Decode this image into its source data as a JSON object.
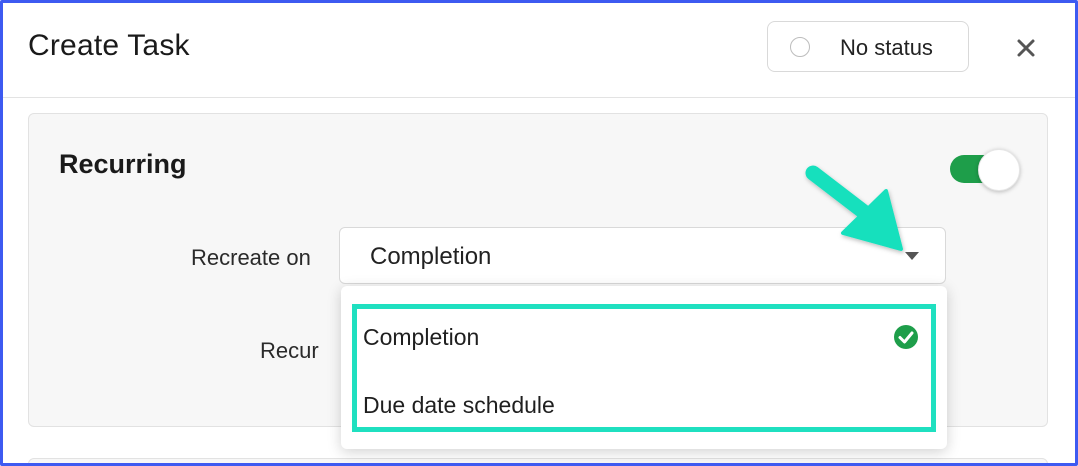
{
  "dialog": {
    "title": "Create Task",
    "status_label": "No status",
    "close_icon": "close-icon"
  },
  "recurring": {
    "title": "Recurring",
    "toggle_on": true,
    "recreate_label": "Recreate on",
    "recreate_value": "Completion",
    "recur_label": "Recur"
  },
  "dropdown": {
    "options": [
      {
        "label": "Completion",
        "selected": true
      },
      {
        "label": "Due date schedule",
        "selected": false
      }
    ]
  },
  "colors": {
    "accent_border": "#3d5af1",
    "toggle_on": "#1e9e4a",
    "highlight": "#1fe0c0",
    "check": "#1e9e4a"
  }
}
